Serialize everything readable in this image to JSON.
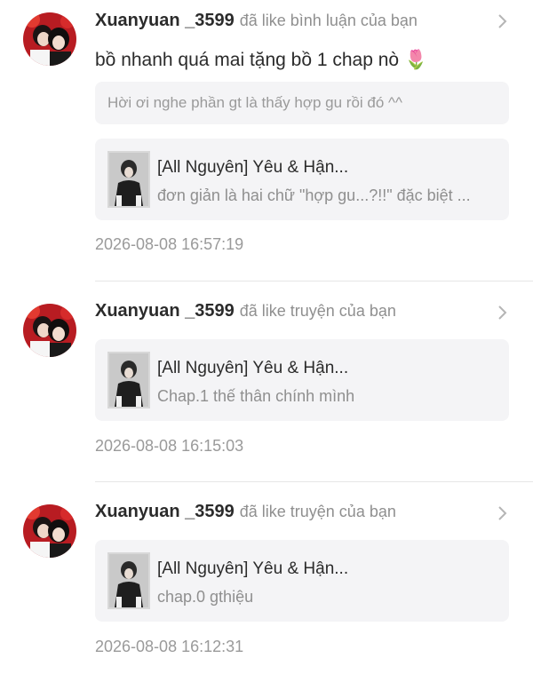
{
  "notifications": [
    {
      "username": "Xuanyuan _3599",
      "action": "đã like bình luận của bạn",
      "comment": "bồ nhanh quá mai tặng bồ 1 chap nò",
      "comment_emoji": "🌷",
      "quoted_comment": "Hời ơi nghe phần gt là thấy hợp gu rồi đó ^^",
      "story_title": "[All Nguyên] Yêu & Hận...",
      "story_subtitle": "đơn giản là hai chữ \"hợp gu...?!!\" đặc biệt ...",
      "timestamp": "2026-08-08 16:57:19"
    },
    {
      "username": "Xuanyuan _3599",
      "action": "đã like truyện của bạn",
      "story_title": "[All Nguyên] Yêu & Hận...",
      "story_subtitle": "Chap.1 thế thân chính mình",
      "timestamp": "2026-08-08 16:15:03"
    },
    {
      "username": "Xuanyuan _3599",
      "action": "đã like truyện của bạn",
      "story_title": "[All Nguyên] Yêu & Hận...",
      "story_subtitle": "chap.0 gthiệu",
      "timestamp": "2026-08-08 16:12:31"
    }
  ],
  "icons": {
    "chevron": "chevron-right-icon",
    "avatar": "avatar-image",
    "thumbnail": "story-cover-thumbnail"
  },
  "colors": {
    "username": "#2b2b2b",
    "secondary_text": "#8f8f8f",
    "card_background": "#f4f4f6",
    "divider": "#e6e6e6"
  }
}
